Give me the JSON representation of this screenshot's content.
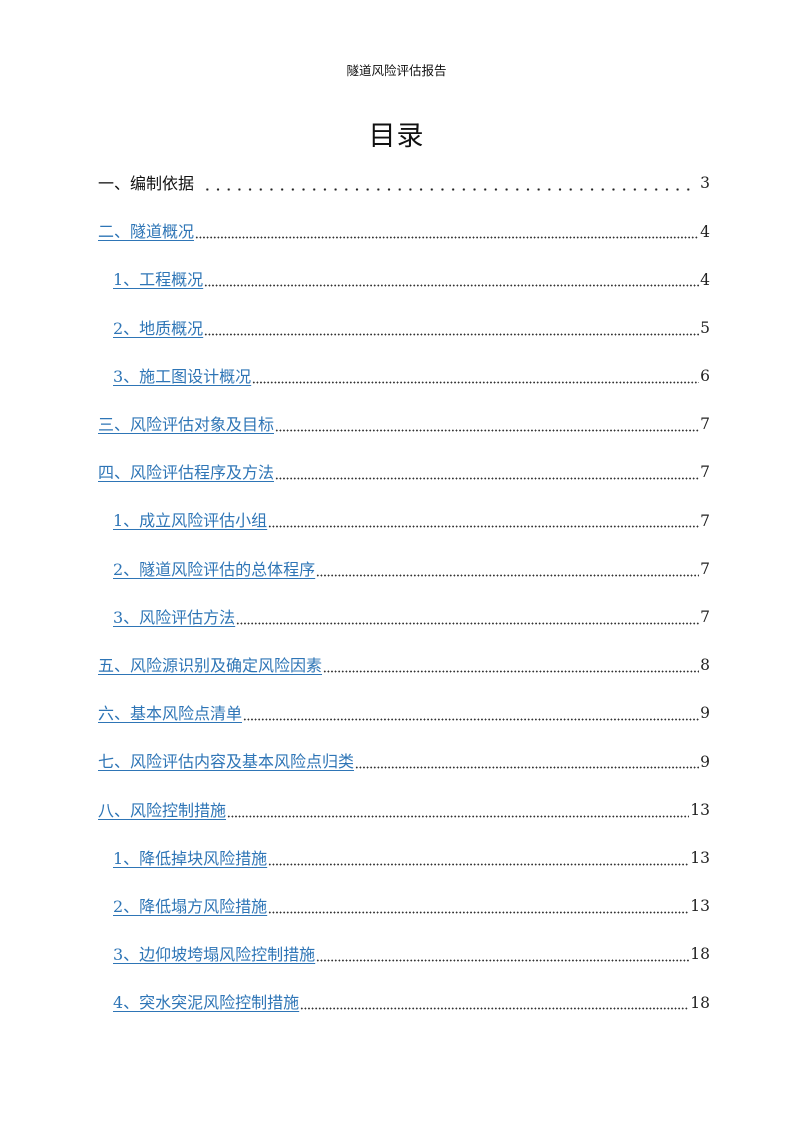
{
  "document": {
    "running_header": "隧道风险评估报告",
    "toc_title": "目录",
    "link_color": "#2e75b6"
  },
  "toc": [
    {
      "label": "一、编制依据",
      "page": "3",
      "level": 1,
      "link": false
    },
    {
      "label": "二、隧道概况",
      "page": "4",
      "level": 1,
      "link": true
    },
    {
      "label": "1、工程概况",
      "page": "4",
      "level": 2,
      "link": true
    },
    {
      "label": "2、地质概况",
      "page": "5",
      "level": 2,
      "link": true
    },
    {
      "label": "3、施工图设计概况",
      "page": "6",
      "level": 2,
      "link": true
    },
    {
      "label": "三、风险评估对象及目标",
      "page": "7",
      "level": 1,
      "link": true
    },
    {
      "label": "四、风险评估程序及方法",
      "page": "7",
      "level": 1,
      "link": true
    },
    {
      "label": "1、成立风险评估小组",
      "page": "7",
      "level": 2,
      "link": true
    },
    {
      "label": "2、隧道风险评估的总体程序",
      "page": "7",
      "level": 2,
      "link": true
    },
    {
      "label": "3、风险评估方法",
      "page": "7",
      "level": 2,
      "link": true
    },
    {
      "label": "五、风险源识别及确定风险因素",
      "page": "8",
      "level": 1,
      "link": true
    },
    {
      "label": "六、基本风险点清单",
      "page": "9",
      "level": 1,
      "link": true
    },
    {
      "label": "七、风险评估内容及基本风险点归类",
      "page": "9",
      "level": 1,
      "link": true
    },
    {
      "label": "八、风险控制措施",
      "page": "13",
      "level": 1,
      "link": true
    },
    {
      "label": "1、降低掉块风险措施",
      "page": "13",
      "level": 2,
      "link": true
    },
    {
      "label": "2、降低塌方风险措施",
      "page": "13",
      "level": 2,
      "link": true
    },
    {
      "label": "3、边仰坡垮塌风险控制措施",
      "page": "18",
      "level": 2,
      "link": true
    },
    {
      "label": "4、突水突泥风险控制措施",
      "page": "18",
      "level": 2,
      "link": true
    }
  ]
}
